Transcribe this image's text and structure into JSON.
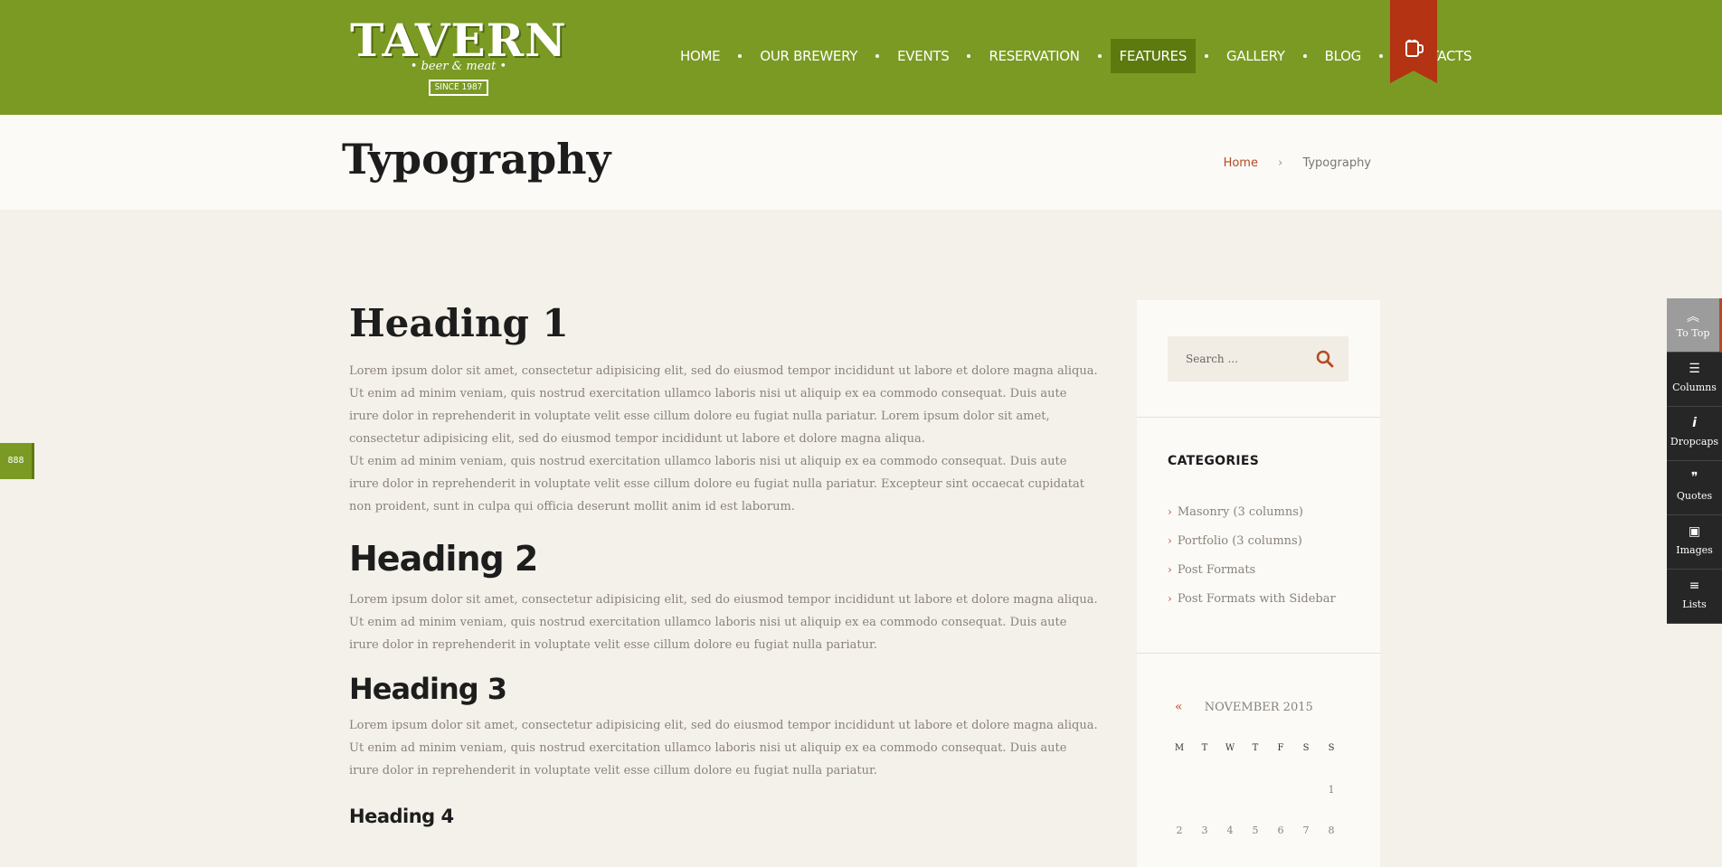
{
  "header": {
    "logo": {
      "name": "TAVERN",
      "tagline": "beer & meat",
      "since": "SINCE 1987"
    },
    "nav": [
      {
        "label": "HOME",
        "active": false
      },
      {
        "label": "OUR BREWERY",
        "active": false
      },
      {
        "label": "EVENTS",
        "active": false
      },
      {
        "label": "RESERVATION",
        "active": false
      },
      {
        "label": "FEATURES",
        "active": true
      },
      {
        "label": "GALLERY",
        "active": false
      },
      {
        "label": "BLOG",
        "active": false
      },
      {
        "label": "CONTACTS",
        "active": false
      }
    ],
    "ribbon_icon": "beer-mug-icon",
    "colors": {
      "bar": "#7a9a24",
      "active": "#5d7a0f",
      "ribbon": "#b33312"
    }
  },
  "titlebar": {
    "title": "Typography",
    "breadcrumb": {
      "home": "Home",
      "separator": "›",
      "current": "Typography"
    }
  },
  "content": {
    "h1": "Heading 1",
    "p1": "Lorem ipsum dolor sit amet, consectetur adipisicing elit, sed do eiusmod tempor incididunt ut labore et dolore magna aliqua. Ut enim ad minim veniam, quis nostrud exercitation ullamco laboris nisi ut aliquip ex ea commodo consequat. Duis aute irure dolor in reprehenderit in voluptate velit esse cillum dolore eu fugiat nulla pariatur. Lorem ipsum dolor sit amet, consectetur adipisicing elit, sed do eiusmod tempor incididunt ut labore et dolore magna aliqua.",
    "p1b": "Ut enim ad minim veniam, quis nostrud exercitation ullamco laboris nisi ut aliquip ex ea commodo consequat. Duis aute irure dolor in reprehenderit in voluptate velit esse cillum dolore eu fugiat nulla pariatur. Excepteur sint occaecat cupidatat non proident, sunt in culpa qui officia deserunt mollit anim id est laborum.",
    "h2": "Heading 2",
    "p2": "Lorem ipsum dolor sit amet, consectetur adipisicing elit, sed do eiusmod tempor incididunt ut labore et dolore magna aliqua. Ut enim ad minim veniam, quis nostrud exercitation ullamco laboris nisi ut aliquip ex ea commodo consequat. Duis aute irure dolor in reprehenderit in voluptate velit esse cillum dolore eu fugiat nulla pariatur.",
    "h3": "Heading 3",
    "p3": "Lorem ipsum dolor sit amet, consectetur adipisicing elit, sed do eiusmod tempor incididunt ut labore et dolore magna aliqua. Ut enim ad minim veniam, quis nostrud exercitation ullamco laboris nisi ut aliquip ex ea commodo consequat. Duis aute irure dolor in reprehenderit in voluptate velit esse cillum dolore eu fugiat nulla pariatur.",
    "h4": "Heading 4"
  },
  "sidebar": {
    "search": {
      "placeholder": "Search ...",
      "icon": "search-icon"
    },
    "categories": {
      "title": "CATEGORIES",
      "items": [
        "Masonry (3 columns)",
        "Portfolio (3 columns)",
        "Post Formats",
        "Post Formats with Sidebar"
      ]
    },
    "calendar": {
      "prev_icon": "double-chevron-left-icon",
      "prev_symbol": "«",
      "month": "NOVEMBER 2015",
      "days_of_week": [
        "M",
        "T",
        "W",
        "T",
        "F",
        "S",
        "S"
      ],
      "weeks": [
        [
          "",
          "",
          "",
          "",
          "",
          "",
          "1"
        ],
        [
          "2",
          "3",
          "4",
          "5",
          "6",
          "7",
          "8"
        ]
      ]
    }
  },
  "toolbar": {
    "items": [
      {
        "label": "To Top",
        "icon": "double-chevron-up-icon",
        "glyph": "︽"
      },
      {
        "label": "Columns",
        "icon": "columns-icon",
        "glyph": "☰"
      },
      {
        "label": "Dropcaps",
        "icon": "info-icon",
        "glyph": "i"
      },
      {
        "label": "Quotes",
        "icon": "quote-icon",
        "glyph": "❞"
      },
      {
        "label": "Images",
        "icon": "images-icon",
        "glyph": "▣"
      },
      {
        "label": "Lists",
        "icon": "list-icon",
        "glyph": "≡"
      }
    ]
  },
  "left_tab": {
    "label": "888",
    "icon": "settings-tab-icon"
  }
}
